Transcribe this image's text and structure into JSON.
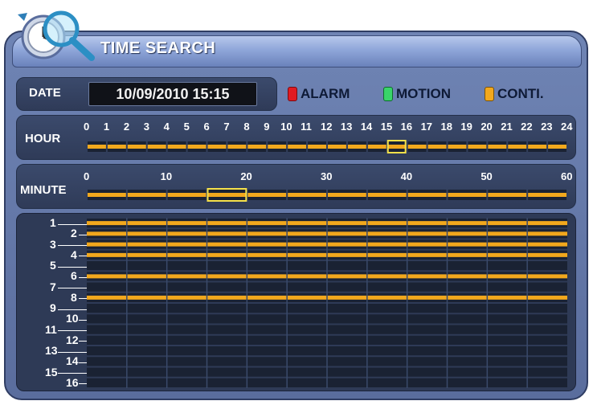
{
  "window": {
    "title": "TIME SEARCH"
  },
  "date": {
    "label": "DATE",
    "value": "10/09/2010 15:15"
  },
  "legend": [
    {
      "label": "ALARM",
      "color": "#e01b23"
    },
    {
      "label": "MOTION",
      "color": "#39d46a"
    },
    {
      "label": "CONTI.",
      "color": "#f2a81d"
    }
  ],
  "hour_bar": {
    "label": "HOUR",
    "ticks": [
      "0",
      "1",
      "2",
      "3",
      "4",
      "5",
      "6",
      "7",
      "8",
      "9",
      "10",
      "11",
      "12",
      "13",
      "14",
      "15",
      "16",
      "17",
      "18",
      "19",
      "20",
      "21",
      "22",
      "23",
      "24"
    ],
    "selected_hour": 15,
    "recorded_hours": [
      0,
      1,
      2,
      3,
      4,
      5,
      6,
      7,
      8,
      9,
      10,
      11,
      12,
      13,
      14,
      15,
      16,
      17,
      18,
      19,
      20,
      21,
      22,
      23
    ]
  },
  "minute_bar": {
    "label": "MINUTE",
    "ticks": [
      "0",
      "10",
      "20",
      "30",
      "40",
      "50",
      "60"
    ],
    "selected_minutes": [
      15,
      20
    ]
  },
  "channel_grid": {
    "channels": [
      "1",
      "2",
      "3",
      "4",
      "5",
      "6",
      "7",
      "8",
      "9",
      "10",
      "11",
      "12",
      "13",
      "14",
      "15",
      "16"
    ],
    "recorded_channels": [
      1,
      2,
      3,
      4,
      6,
      8
    ],
    "recording_type": "CONTI."
  },
  "colors": {
    "recording": "#f2a81d",
    "track": "#1a2233",
    "selection": "#f6e14a",
    "divider": "#3a4a6a"
  }
}
